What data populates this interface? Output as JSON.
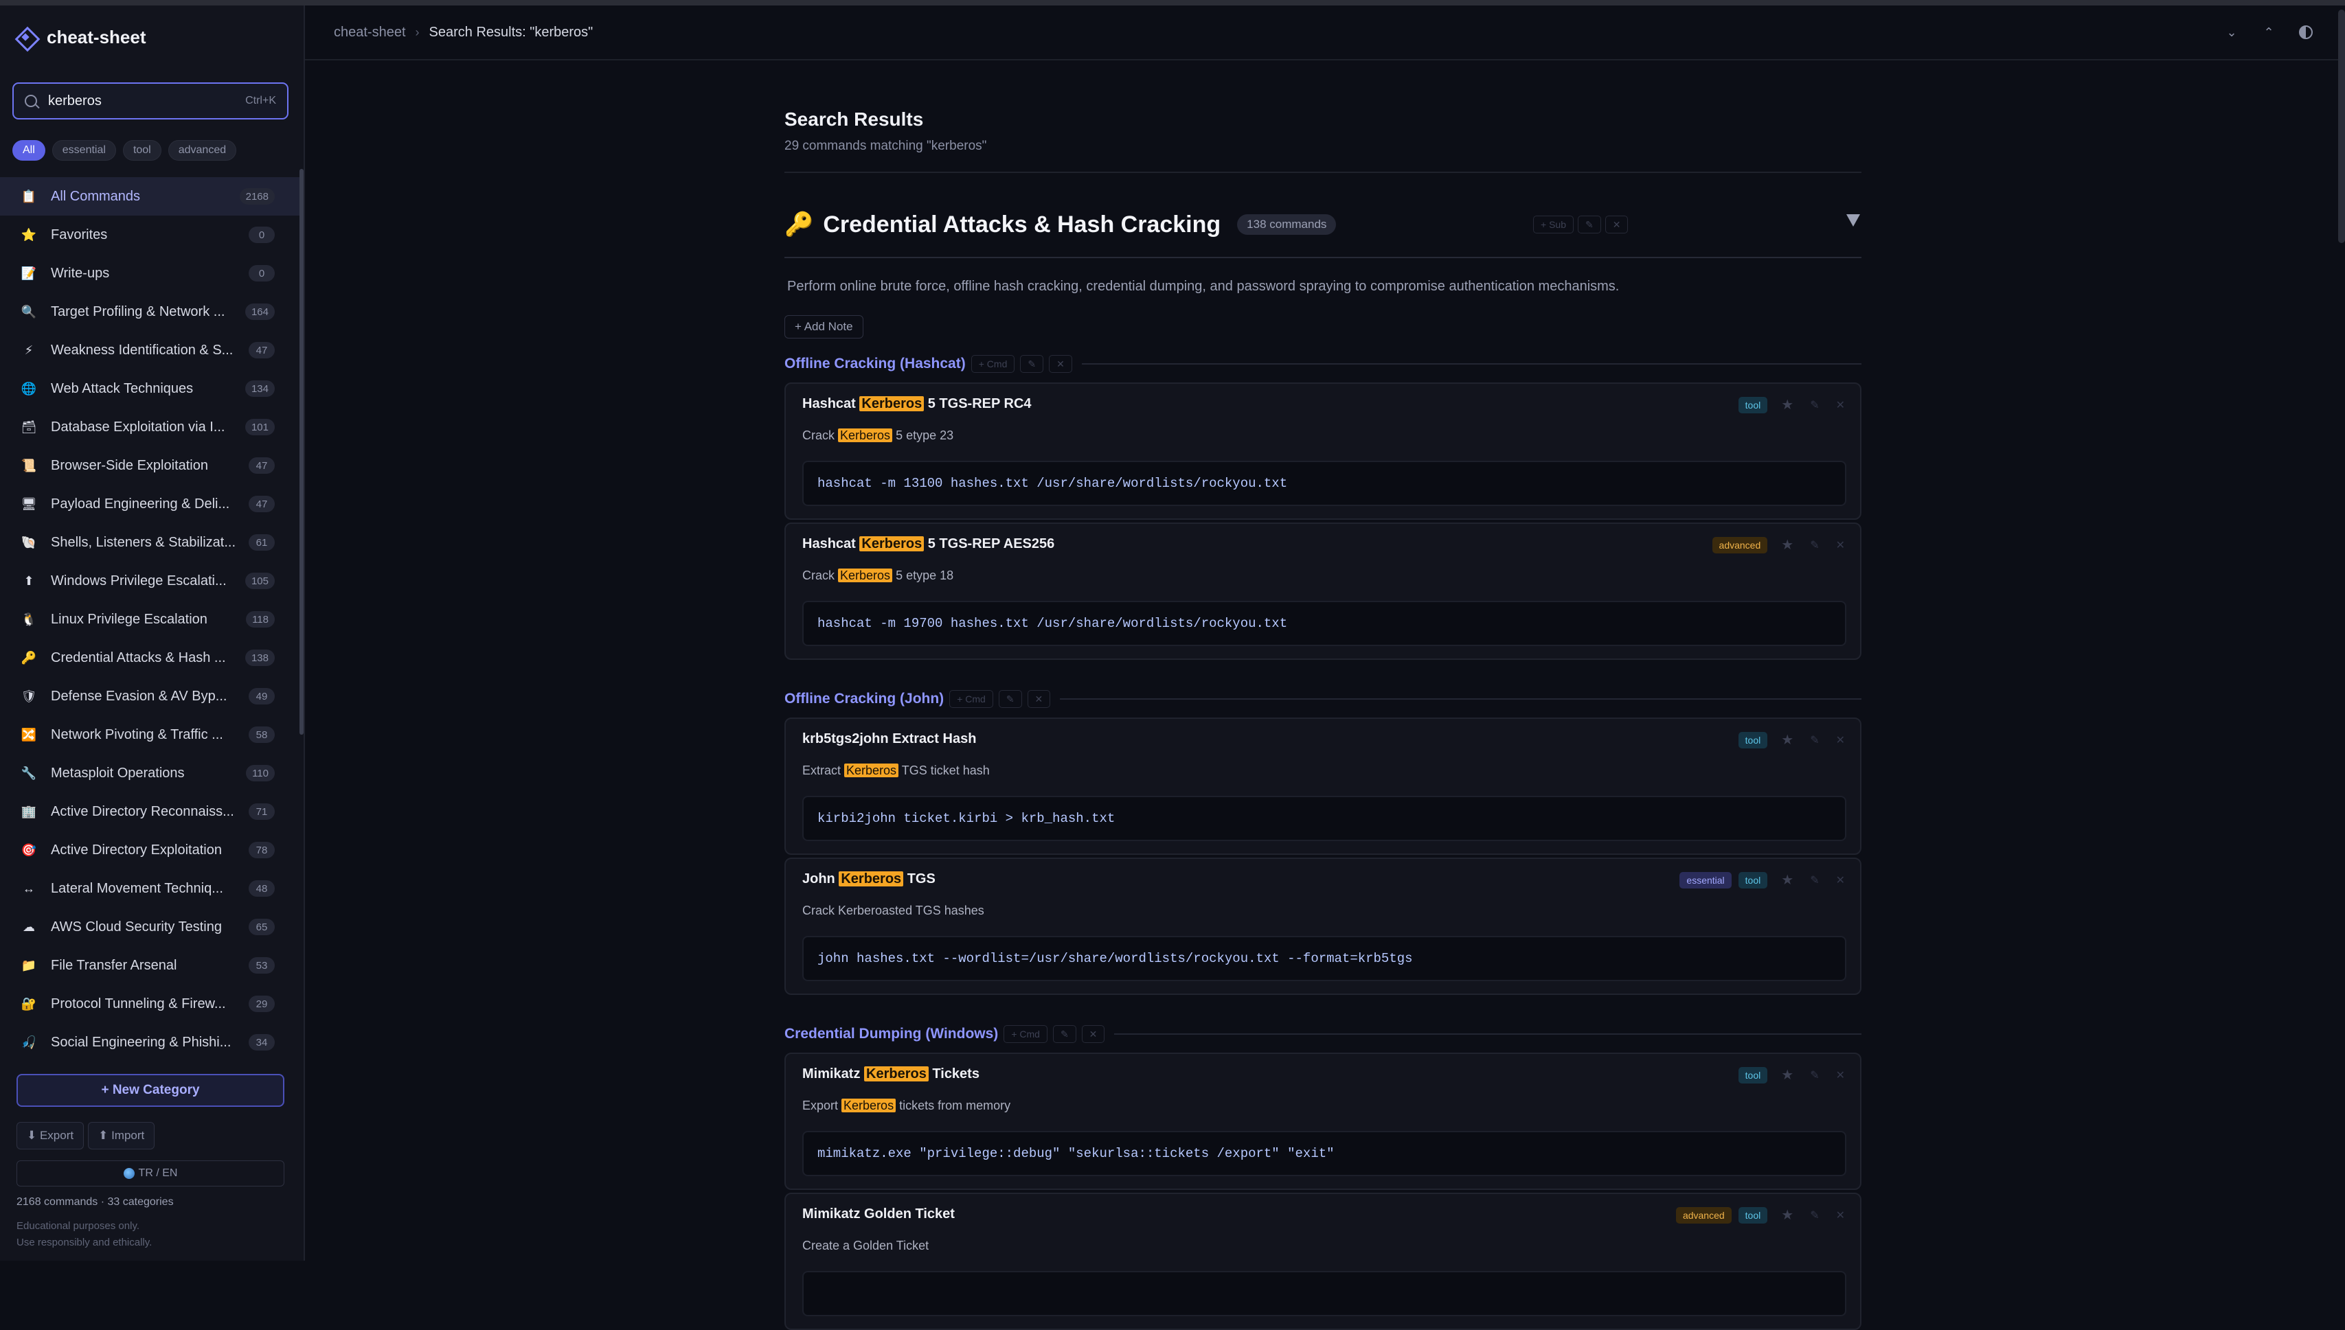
{
  "app": {
    "name": "cheat-sheet"
  },
  "search": {
    "value": "kerberos",
    "shortcut": "Ctrl+K"
  },
  "filters": [
    {
      "label": "All",
      "active": true
    },
    {
      "label": "essential",
      "active": false
    },
    {
      "label": "tool",
      "active": false
    },
    {
      "label": "advanced",
      "active": false
    }
  ],
  "categories": [
    {
      "label": "All Commands",
      "count": "2168",
      "icon": "clipboard-icon",
      "glyph": "📋",
      "active": true
    },
    {
      "label": "Favorites",
      "count": "0",
      "icon": "star-icon",
      "glyph": "⭐"
    },
    {
      "label": "Write-ups",
      "count": "0",
      "icon": "memo-icon",
      "glyph": "📝"
    },
    {
      "label": "Target Profiling & Network ...",
      "count": "164",
      "icon": "magnifier-icon",
      "glyph": "🔍"
    },
    {
      "label": "Weakness Identification & S...",
      "count": "47",
      "icon": "lightning-icon",
      "glyph": "⚡"
    },
    {
      "label": "Web Attack Techniques",
      "count": "134",
      "icon": "globe-icon",
      "glyph": "🌐"
    },
    {
      "label": "Database Exploitation via I...",
      "count": "101",
      "icon": "database-icon",
      "glyph": "🗃"
    },
    {
      "label": "Browser-Side Exploitation",
      "count": "47",
      "icon": "scroll-icon",
      "glyph": "📜"
    },
    {
      "label": "Payload Engineering & Deli...",
      "count": "47",
      "icon": "monitor-icon",
      "glyph": "🖥"
    },
    {
      "label": "Shells, Listeners & Stabilizat...",
      "count": "61",
      "icon": "shell-icon",
      "glyph": "🐚"
    },
    {
      "label": "Windows Privilege Escalati...",
      "count": "105",
      "icon": "up-arrow-icon",
      "glyph": "⬆"
    },
    {
      "label": "Linux Privilege Escalation",
      "count": "118",
      "icon": "penguin-icon",
      "glyph": "🐧"
    },
    {
      "label": "Credential Attacks & Hash ...",
      "count": "138",
      "icon": "key-icon",
      "glyph": "🔑"
    },
    {
      "label": "Defense Evasion & AV Byp...",
      "count": "49",
      "icon": "shield-icon",
      "glyph": "🛡"
    },
    {
      "label": "Network Pivoting & Traffic ...",
      "count": "58",
      "icon": "pivot-icon",
      "glyph": "🔀"
    },
    {
      "label": "Metasploit Operations",
      "count": "110",
      "icon": "wrench-icon",
      "glyph": "🔧"
    },
    {
      "label": "Active Directory Reconnaiss...",
      "count": "71",
      "icon": "building-icon",
      "glyph": "🏢"
    },
    {
      "label": "Active Directory Exploitation",
      "count": "78",
      "icon": "target-icon",
      "glyph": "🎯"
    },
    {
      "label": "Lateral Movement Techniq...",
      "count": "48",
      "icon": "left-right-arrow-icon",
      "glyph": "↔"
    },
    {
      "label": "AWS Cloud Security Testing",
      "count": "65",
      "icon": "cloud-icon",
      "glyph": "☁"
    },
    {
      "label": "File Transfer Arsenal",
      "count": "53",
      "icon": "folder-icon",
      "glyph": "📁"
    },
    {
      "label": "Protocol Tunneling & Firew...",
      "count": "29",
      "icon": "lock-key-icon",
      "glyph": "🔐"
    },
    {
      "label": "Social Engineering & Phishi...",
      "count": "34",
      "icon": "fishing-icon",
      "glyph": "🎣"
    }
  ],
  "sidebar_footer": {
    "new_category": "+ New Category",
    "export": "⬇ Export",
    "import": "⬆ Import",
    "language": "TR / EN",
    "stats": "2168 commands · 33 categories",
    "disclaimer_1": "Educational purposes only.",
    "disclaimer_2": "Use responsibly and ethically."
  },
  "topbar": {
    "crumb_root": "cheat-sheet",
    "crumb_sep": "›",
    "crumb_current": "Search Results: \"kerberos\""
  },
  "results": {
    "title": "Search Results",
    "subtitle": "29 commands matching \"kerberos\""
  },
  "category": {
    "title": "Credential Attacks & Hash Cracking",
    "badge": "138 commands",
    "description": "Perform online brute force, offline hash cracking, credential dumping, and password spraying to compromise authentication mechanisms.",
    "add_note": "+ Add Note",
    "ghost_sub": "+ Sub",
    "ghost_edit": "✎",
    "ghost_delete": "✕",
    "ghost_cmd": "+ Cmd"
  },
  "subsections": [
    {
      "title": "Offline Cracking (Hashcat)",
      "cards": [
        {
          "title_pre": "Hashcat ",
          "title_hl": "Kerberos",
          "title_post": " 5 TGS-REP RC4",
          "desc_pre": "Crack ",
          "desc_hl": "Kerberos",
          "desc_post": " 5 etype 23",
          "code": "hashcat -m 13100 hashes.txt /usr/share/wordlists/rockyou.txt",
          "tags": [
            "tool"
          ]
        },
        {
          "title_pre": "Hashcat ",
          "title_hl": "Kerberos",
          "title_post": " 5 TGS-REP AES256",
          "desc_pre": "Crack ",
          "desc_hl": "Kerberos",
          "desc_post": " 5 etype 18",
          "code": "hashcat -m 19700 hashes.txt /usr/share/wordlists/rockyou.txt",
          "tags": [
            "advanced"
          ]
        }
      ]
    },
    {
      "title": "Offline Cracking (John)",
      "cards": [
        {
          "title_pre": "krb5tgs2john Extract Hash",
          "title_hl": "",
          "title_post": "",
          "desc_pre": "Extract ",
          "desc_hl": "Kerberos",
          "desc_post": " TGS ticket hash",
          "code": "kirbi2john ticket.kirbi > krb_hash.txt",
          "tags": [
            "tool"
          ]
        },
        {
          "title_pre": "John ",
          "title_hl": "Kerberos",
          "title_post": " TGS",
          "desc_pre": "Crack Kerberoasted TGS hashes",
          "desc_hl": "",
          "desc_post": "",
          "code": "john hashes.txt --wordlist=/usr/share/wordlists/rockyou.txt --format=krb5tgs",
          "tags": [
            "essential",
            "tool"
          ]
        }
      ]
    },
    {
      "title": "Credential Dumping (Windows)",
      "cards": [
        {
          "title_pre": "Mimikatz ",
          "title_hl": "Kerberos",
          "title_post": " Tickets",
          "desc_pre": "Export ",
          "desc_hl": "Kerberos",
          "desc_post": " tickets from memory",
          "code": "mimikatz.exe \"privilege::debug\" \"sekurlsa::tickets /export\" \"exit\"",
          "tags": [
            "tool"
          ]
        },
        {
          "title_pre": "Mimikatz Golden Ticket",
          "title_hl": "",
          "title_post": "",
          "desc_pre": "Create a Golden Ticket",
          "desc_hl": "",
          "desc_post": "",
          "code": "",
          "tags": [
            "advanced",
            "tool"
          ]
        }
      ]
    }
  ],
  "card_actions": {
    "star": "★",
    "edit": "✎",
    "delete": "✕"
  },
  "colors": {
    "accent": "#6d74f2",
    "highlight": "#f5a524",
    "tool_tag": "#5fc6e8",
    "advanced_tag": "#f0b34a",
    "essential_tag": "#a2a8ff"
  }
}
